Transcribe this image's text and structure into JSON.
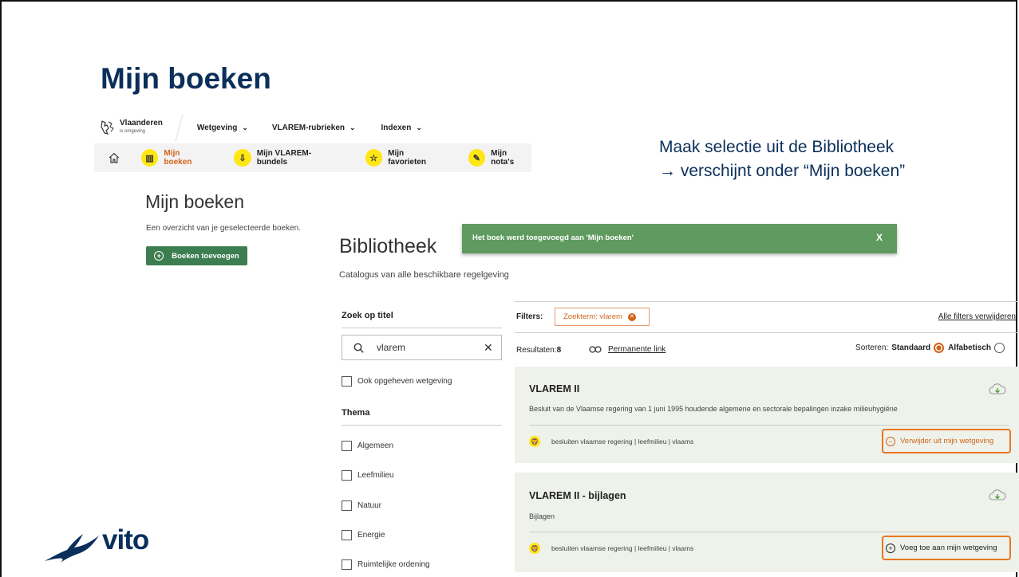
{
  "slide": {
    "title": "Mijn boeken",
    "annotation_line1": "Maak selectie uit de Bibliotheek",
    "annotation_line2": "→ verschijnt onder “Mijn boeken”",
    "logo_text": "vito"
  },
  "nav": {
    "logo_title": "Vlaanderen",
    "logo_subtitle": "is omgeving",
    "menu": [
      {
        "label": "Wetgeving"
      },
      {
        "label": "VLAREM-rubrieken"
      },
      {
        "label": "Indexen"
      }
    ],
    "subnav": [
      {
        "label": "Mijn boeken",
        "icon": "books-icon",
        "active": true
      },
      {
        "label": "Mijn VLAREM-bundels",
        "icon": "cloud-download-icon"
      },
      {
        "label": "Mijn favorieten",
        "icon": "star-icon"
      },
      {
        "label": "Mijn nota's",
        "icon": "pencil-icon"
      }
    ]
  },
  "mijn_boeken": {
    "heading": "Mijn boeken",
    "subtitle": "Een overzicht van je geselecteerde boeken.",
    "add_button": "Boeken toevoegen"
  },
  "bibliotheek": {
    "heading": "Bibliotheek",
    "subtitle": "Catalogus van alle beschikbare regelgeving",
    "toast_message": "Het boek werd toegevoegd aan 'Mijn boeken'",
    "toast_close": "X"
  },
  "sidebar": {
    "search_label": "Zoek op titel",
    "search_value": "vlarem",
    "clear_symbol": "✕",
    "include_repealed": "Ook opgeheven wetgeving",
    "theme_label": "Thema",
    "themes": [
      "Algemeen",
      "Leefmilieu",
      "Natuur",
      "Energie",
      "Ruimtelijke ordening"
    ]
  },
  "results": {
    "filters_label": "Filters:",
    "filter_chip": "Zoekterm: vlarem",
    "clear_filters": "Alle filters verwijderen",
    "count_label": "Resultaten:",
    "count_value": "8",
    "permalink": "Permanente link",
    "sort_label": "Sorteren:",
    "sort_options": [
      "Standaard",
      "Alfabetisch"
    ],
    "sort_selected": "Standaard",
    "items": [
      {
        "title": "VLAREM II",
        "description": "Besluit van de Vlaamse regering van 1 juni 1995 houdende algemene en sectorale bepalingen inzake milieuhygiëne",
        "tags": "besluiten vlaamse regering | leefmilieu | vlaams",
        "action": "Verwijder uit mijn wetgeving",
        "action_symbol": "−"
      },
      {
        "title": "VLAREM II - bijlagen",
        "description": "Bijlagen",
        "tags": "besluiten vlaamse regering | leefmilieu | vlaams",
        "action": "Voeg toe aan mijn wetgeving",
        "action_symbol": "+"
      }
    ]
  },
  "colors": {
    "title_blue": "#0b2f5b",
    "accent_orange": "#e87722",
    "toast_green": "#5f9a5f",
    "button_green": "#3d7e51",
    "flanders_yellow": "#ffe615"
  }
}
